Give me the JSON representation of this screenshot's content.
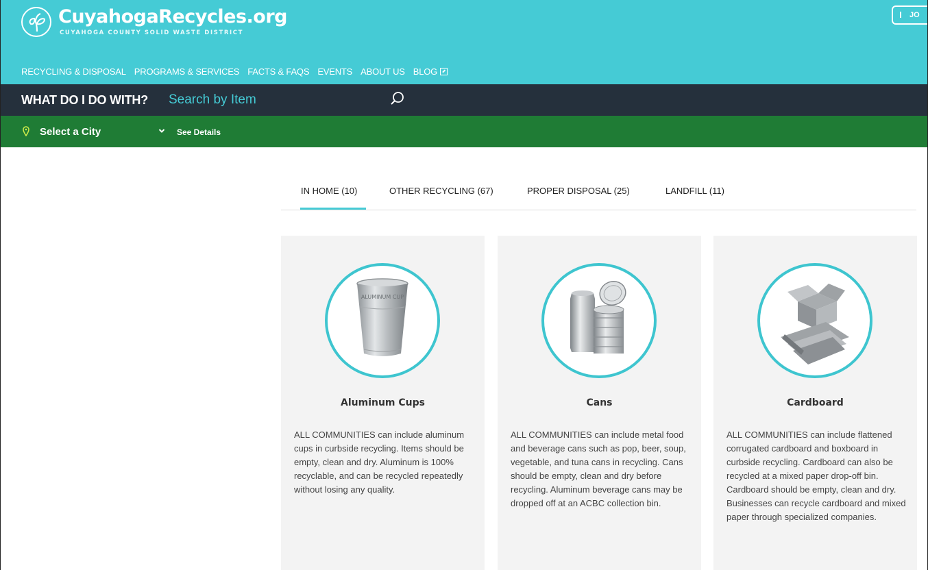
{
  "header": {
    "site_name": "CuyahogaRecycles.org",
    "subtitle": "CUYAHOGA COUNTY SOLID WASTE DISTRICT",
    "join_label": "JO",
    "brand_color": "#45cbd5"
  },
  "nav": {
    "items": [
      {
        "label": "RECYCLING & DISPOSAL"
      },
      {
        "label": "PROGRAMS & SERVICES"
      },
      {
        "label": "FACTS & FAQS"
      },
      {
        "label": "EVENTS"
      },
      {
        "label": "ABOUT US"
      },
      {
        "label": "BLOG"
      }
    ]
  },
  "search": {
    "heading": "WHAT DO I DO WITH?",
    "placeholder": "Search by Item"
  },
  "city": {
    "selected": "Select a City",
    "details_link": "See Details",
    "bar_color": "#1f7c35"
  },
  "tabs": [
    {
      "label": "IN HOME (10)",
      "active": true
    },
    {
      "label": "OTHER RECYCLING (67)",
      "active": false
    },
    {
      "label": "PROPER DISPOSAL (25)",
      "active": false
    },
    {
      "label": "LANDFILL (11)",
      "active": false
    }
  ],
  "cards": [
    {
      "title": "Aluminum Cups",
      "image_text": "ALUMINUM CUP",
      "description": "ALL COMMUNITIES can include aluminum cups in curbside recycling. Items should be empty, clean and dry. Aluminum is 100% recyclable, and can be recycled repeatedly without losing any quality."
    },
    {
      "title": "Cans",
      "description": "ALL COMMUNITIES can include metal food and beverage cans such as pop, beer, soup, vegetable, and tuna cans in recycling. Cans should be empty, clean and dry before recycling. Aluminum beverage cans may be dropped off at an ACBC collection bin."
    },
    {
      "title": "Cardboard",
      "description": "ALL COMMUNITIES can include flattened corrugated cardboard and boxboard in curbside recycling. Cardboard can also be recycled at a mixed paper drop-off bin. Cardboard should be empty, clean and dry. Businesses can recycle cardboard and mixed paper through specialized companies."
    }
  ]
}
